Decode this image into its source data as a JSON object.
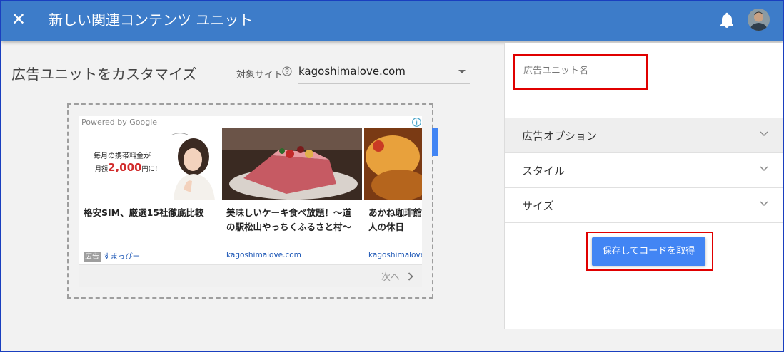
{
  "header": {
    "title": "新しい関連コンテンツ ユニット",
    "close_icon": "close-icon",
    "notification_icon": "bell-icon",
    "avatar": "user-avatar"
  },
  "customize": {
    "heading": "広告ユニットをカスタマイズ",
    "site_label": "対象サイト",
    "site_value": "kagoshimalove.com"
  },
  "preview": {
    "powered_by": "Powered by Google",
    "items": [
      {
        "banner_line1": "毎月の携帯料金が",
        "banner_line2_prefix": "月額",
        "banner_price": "2,000",
        "banner_line2_suffix": "円に！",
        "title": "格安SIM、厳選15社徹底比較",
        "ad_badge": "広告",
        "domain": "すまっぴー"
      },
      {
        "title": "美味しいケーキ食べ放題！～道の駅松山やっちくふるさと村～",
        "domain": "kagoshimalove.com"
      },
      {
        "title": "あかね珈琲館ンチ～老舗コり大人の休日",
        "domain": "kagoshimalove.com"
      }
    ],
    "next_label": "次へ"
  },
  "panel": {
    "name_placeholder": "広告ユニット名",
    "sections": [
      {
        "label": "広告オプション"
      },
      {
        "label": "スタイル"
      },
      {
        "label": "サイズ"
      }
    ],
    "save_label": "保存してコードを取得"
  },
  "colors": {
    "header_bg": "#3d7cc9",
    "button_bg": "#4285f4",
    "highlight": "#e00000"
  }
}
